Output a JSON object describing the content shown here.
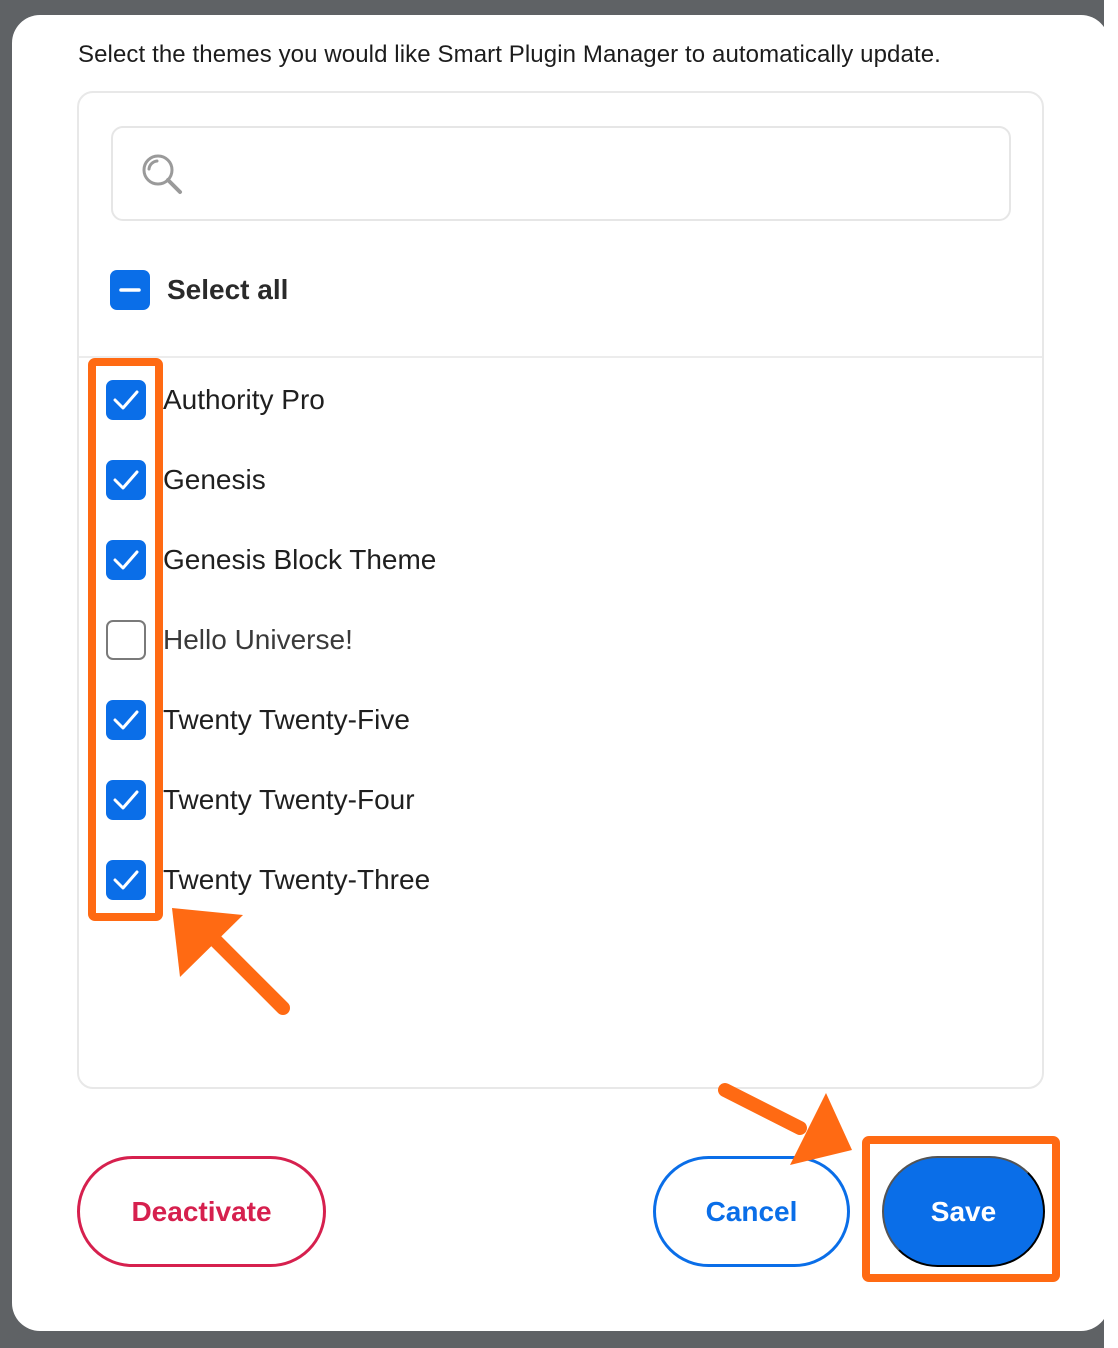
{
  "modal": {
    "intro_text": "Select the themes you would like Smart Plugin Manager to automatically update."
  },
  "search": {
    "icon": "search-icon",
    "value": "",
    "placeholder": ""
  },
  "select_all": {
    "label": "Select all",
    "state": "indeterminate"
  },
  "themes": [
    {
      "label": "Authority Pro",
      "checked": true
    },
    {
      "label": "Genesis",
      "checked": true
    },
    {
      "label": "Genesis Block Theme",
      "checked": true
    },
    {
      "label": "Hello Universe!",
      "checked": false
    },
    {
      "label": "Twenty Twenty-Five",
      "checked": true
    },
    {
      "label": "Twenty Twenty-Four",
      "checked": true
    },
    {
      "label": "Twenty Twenty-Three",
      "checked": true
    }
  ],
  "buttons": {
    "deactivate": "Deactivate",
    "cancel": "Cancel",
    "save": "Save"
  },
  "colors": {
    "primary": "#0a6ee8",
    "danger": "#d6204e",
    "annotation": "#ff6a13"
  }
}
